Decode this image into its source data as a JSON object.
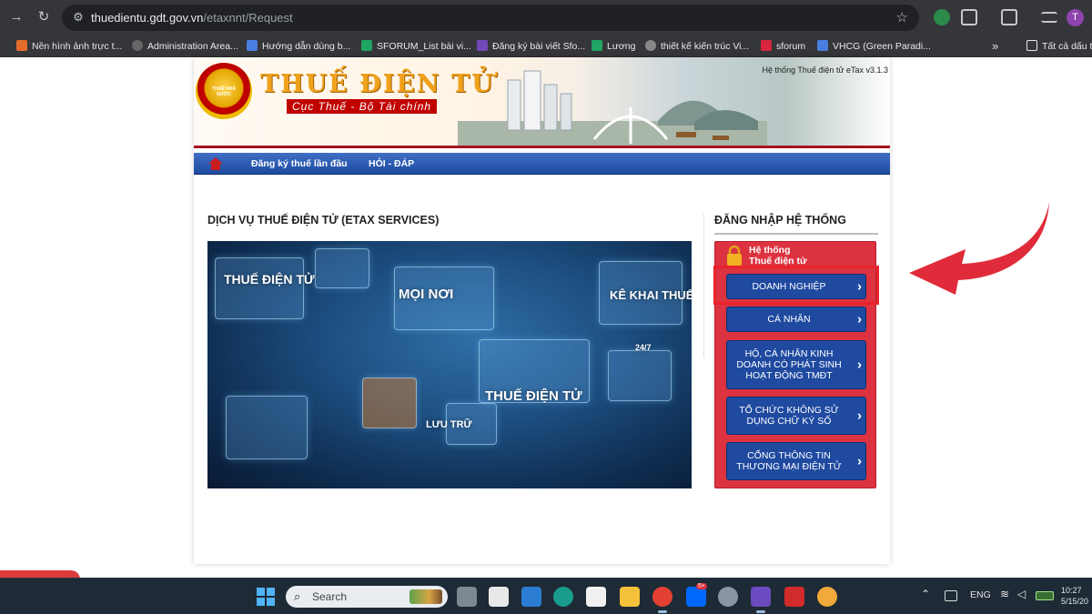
{
  "browser": {
    "url_host": "thuedientu.gdt.gov.vn",
    "url_path": "/etaxnnt/Request",
    "profile_initial": "T",
    "bookmarks": [
      {
        "label": "Nền hình ảnh trực t...",
        "icon": "video-icon",
        "color": "#e36c2b"
      },
      {
        "label": "Administration Area...",
        "icon": "globe-icon",
        "color": "#666666"
      },
      {
        "label": "Hướng dẫn dùng b...",
        "icon": "doc-icon",
        "color": "#4a7ee0"
      },
      {
        "label": "SFORUM_List bài vi...",
        "icon": "sheet-icon",
        "color": "#1fa463"
      },
      {
        "label": "Đăng ký bài viết Sfo...",
        "icon": "form-icon",
        "color": "#7248b9"
      },
      {
        "label": "Lương",
        "icon": "sheet-icon",
        "color": "#1fa463"
      },
      {
        "label": "thiết kế kiến trúc Vi...",
        "icon": "globe-icon",
        "color": "#888888"
      },
      {
        "label": "sforum",
        "icon": "s-icon",
        "color": "#d7263d"
      },
      {
        "label": "VHCG (Green Paradi...",
        "icon": "doc-icon",
        "color": "#4a7ee0"
      }
    ],
    "more_bookmarks": "»",
    "all_bookmarks": "Tất cả dấu t"
  },
  "site": {
    "brand_title": "THUẾ ĐIỆN TỬ",
    "brand_subtitle": "Cục Thuế - Bộ Tài chính",
    "emblem_text": "THUẾ NHÀ NƯỚC",
    "version": "Hệ thống Thuế điện tử eTax v3.1.3",
    "menu": [
      "Đăng ký thuế lần đầu",
      "HỎI - ĐÁP"
    ],
    "services_title": "DỊCH VỤ THUẾ ĐIỆN TỬ (ETAX SERVICES)",
    "hero_labels": [
      "THUẾ ĐIỆN TỬ",
      "MỌI NƠI",
      "KÊ KHAI THUẾ",
      "THUẾ ĐIỆN TỬ",
      "LƯU TRỮ",
      "24/7"
    ],
    "login_title": "ĐĂNG NHẬP HỆ THỐNG",
    "system_line1": "Hệ thống",
    "system_line2": "Thuế điện tử",
    "login_buttons": [
      {
        "label": "DOANH NGHIỆP"
      },
      {
        "label": "CÁ NHÂN"
      },
      {
        "label": "HỘ, CÁ NHÂN KINH DOANH CÓ PHÁT SINH HOẠT ĐỘNG TMĐT"
      },
      {
        "label": "TỔ CHỨC KHÔNG SỬ DỤNG CHỮ KÝ SỐ"
      },
      {
        "label": "CỔNG THÔNG TIN THƯƠNG MẠI ĐIỆN TỬ"
      }
    ],
    "highlight_color": "#e8222b"
  },
  "taskbar": {
    "search_text": "Search",
    "language": "ENG",
    "time": "10:27",
    "date": "5/15/20",
    "zalo_badge": "5+"
  }
}
